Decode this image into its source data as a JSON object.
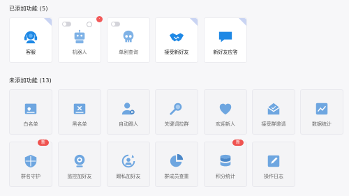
{
  "added_section": {
    "title": "已添加功能 (5)"
  },
  "added_items": [
    {
      "label": "客服",
      "icon": "headset-icon",
      "status": "on"
    },
    {
      "label": "机器人",
      "icon": "robot-icon",
      "status": "off",
      "badge_count": "·"
    },
    {
      "label": "单剧查询",
      "icon": "skull-icon",
      "status": "off"
    },
    {
      "label": "接受新好友",
      "icon": "handshake-icon",
      "status": "on"
    },
    {
      "label": "新好友应答",
      "icon": "chat-bubble-icon",
      "status": "on"
    }
  ],
  "unadded_section": {
    "title": "未添加功能 (13)"
  },
  "unadded_items": [
    {
      "label": "白名单",
      "icon": "whitelist-icon"
    },
    {
      "label": "黑名单",
      "icon": "blacklist-icon"
    },
    {
      "label": "自动踢人",
      "icon": "kick-user-icon"
    },
    {
      "label": "关键词拉群",
      "icon": "keyword-search-icon"
    },
    {
      "label": "欢迎新人",
      "icon": "heart-icon"
    },
    {
      "label": "接受群邀请",
      "icon": "envelope-icon"
    },
    {
      "label": "数据统计",
      "icon": "line-chart-icon"
    },
    {
      "label": "群名守护",
      "icon": "shield-icon",
      "badge": "新"
    },
    {
      "label": "监控加好友",
      "icon": "webcam-icon"
    },
    {
      "label": "踢私加好友",
      "icon": "refresh-user-icon"
    },
    {
      "label": "群成员查重",
      "icon": "pie-chart-icon"
    },
    {
      "label": "积分统计",
      "icon": "database-icon",
      "badge": "新"
    },
    {
      "label": "操作日志",
      "icon": "edit-log-icon"
    }
  ],
  "colors": {
    "accent": "#1e88e5",
    "inactive_icon": "#6ea6e0",
    "badge_red": "#ef5350"
  }
}
